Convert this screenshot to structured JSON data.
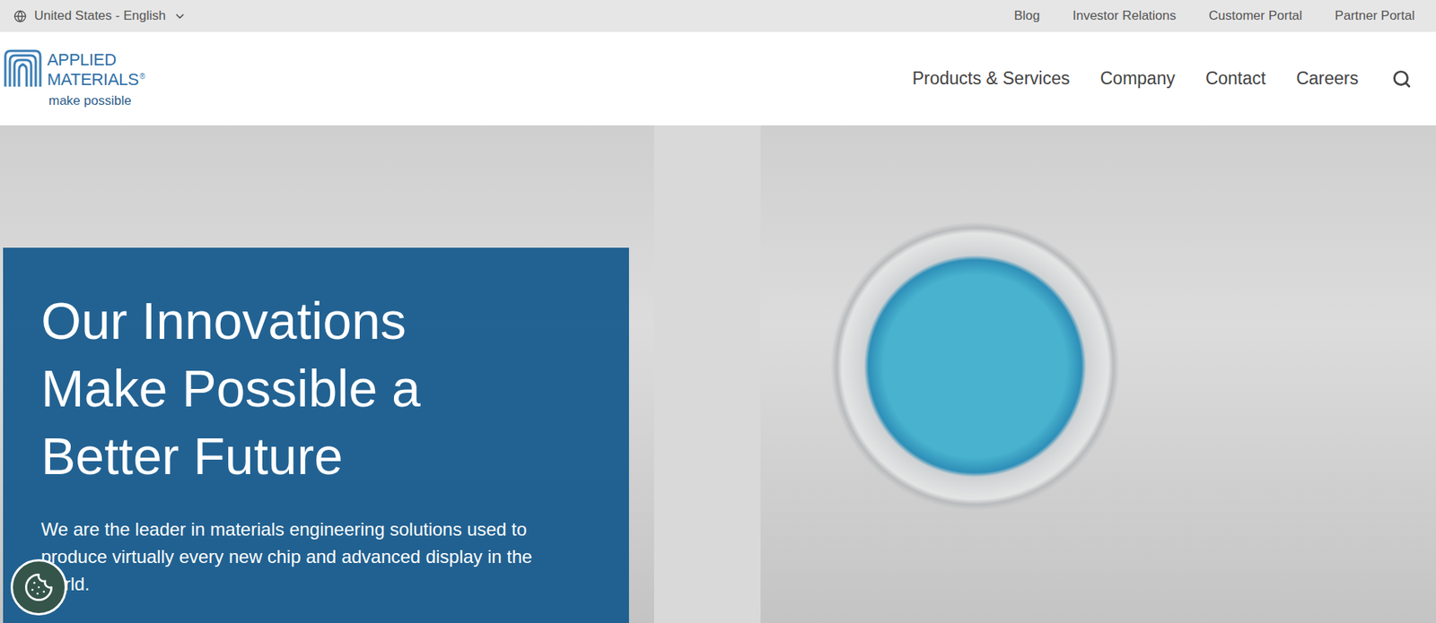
{
  "top_bar": {
    "locale": {
      "label": "United States - English"
    },
    "links": [
      "Blog",
      "Investor Relations",
      "Customer Portal",
      "Partner Portal"
    ]
  },
  "header": {
    "logo": {
      "line1": "APPLIED",
      "line2": "MATERIALS",
      "mark": "®",
      "tagline": "make possible"
    },
    "nav": [
      "Products & Services",
      "Company",
      "Contact",
      "Careers"
    ]
  },
  "hero": {
    "title": "Our Innovations Make Possible a Better Future",
    "text": "We are the leader in materials engineering solutions used to produce virtually every new chip and advanced display in the world."
  }
}
